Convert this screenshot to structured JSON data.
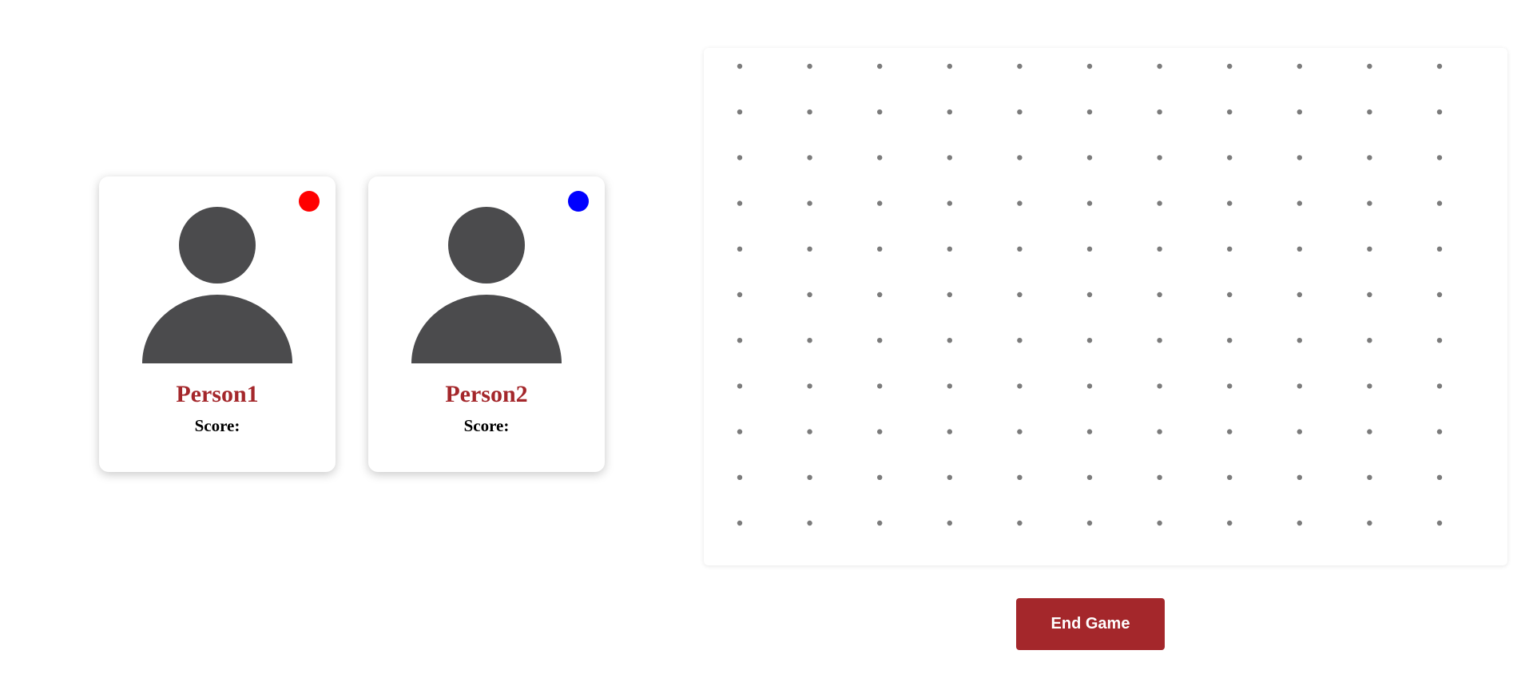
{
  "players": [
    {
      "name": "Person1",
      "score_label": "Score:",
      "color": "#ff0000",
      "icon": "user-silhouette-icon"
    },
    {
      "name": "Person2",
      "score_label": "Score:",
      "color": "#0000ff",
      "icon": "user-silhouette-icon"
    }
  ],
  "board": {
    "rows": 11,
    "cols": 11,
    "dot_color": "#7b7b7b"
  },
  "controls": {
    "end_game_label": "End Game"
  }
}
